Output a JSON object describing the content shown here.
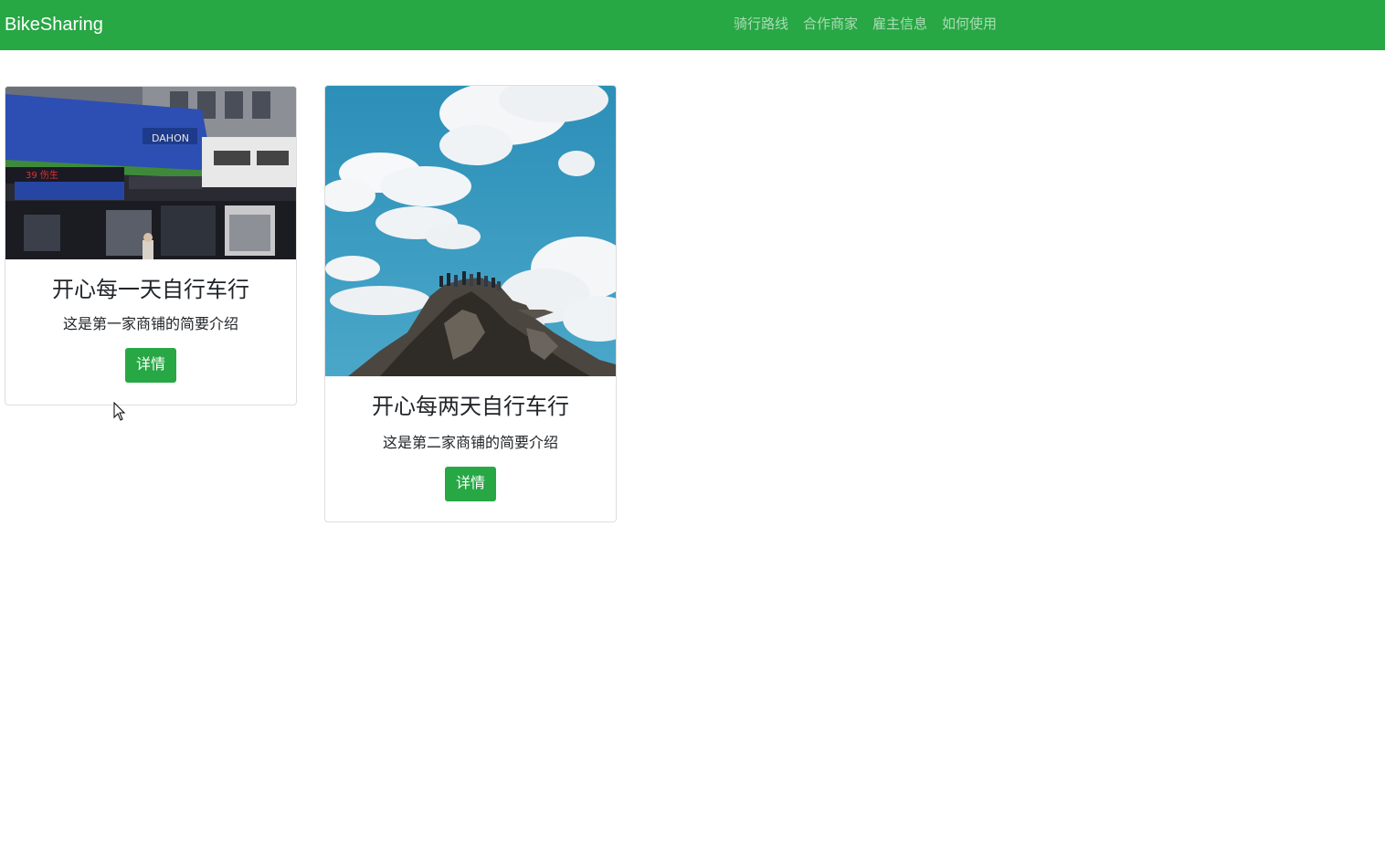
{
  "navbar": {
    "brand": "BikeSharing",
    "links": [
      "骑行路线",
      "合作商家",
      "雇主信息",
      "如何使用"
    ],
    "bg_color": "#28a745"
  },
  "cards": [
    {
      "title": "开心每一天自行车行",
      "text": "这是第一家商铺的简要介绍",
      "button": "详情",
      "image": "storefront-photo"
    },
    {
      "title": "开心每两天自行车行",
      "text": "这是第二家商铺的简要介绍",
      "button": "详情",
      "image": "mountain-sky-photo"
    }
  ],
  "colors": {
    "accent": "#28a745",
    "text": "#212529"
  }
}
